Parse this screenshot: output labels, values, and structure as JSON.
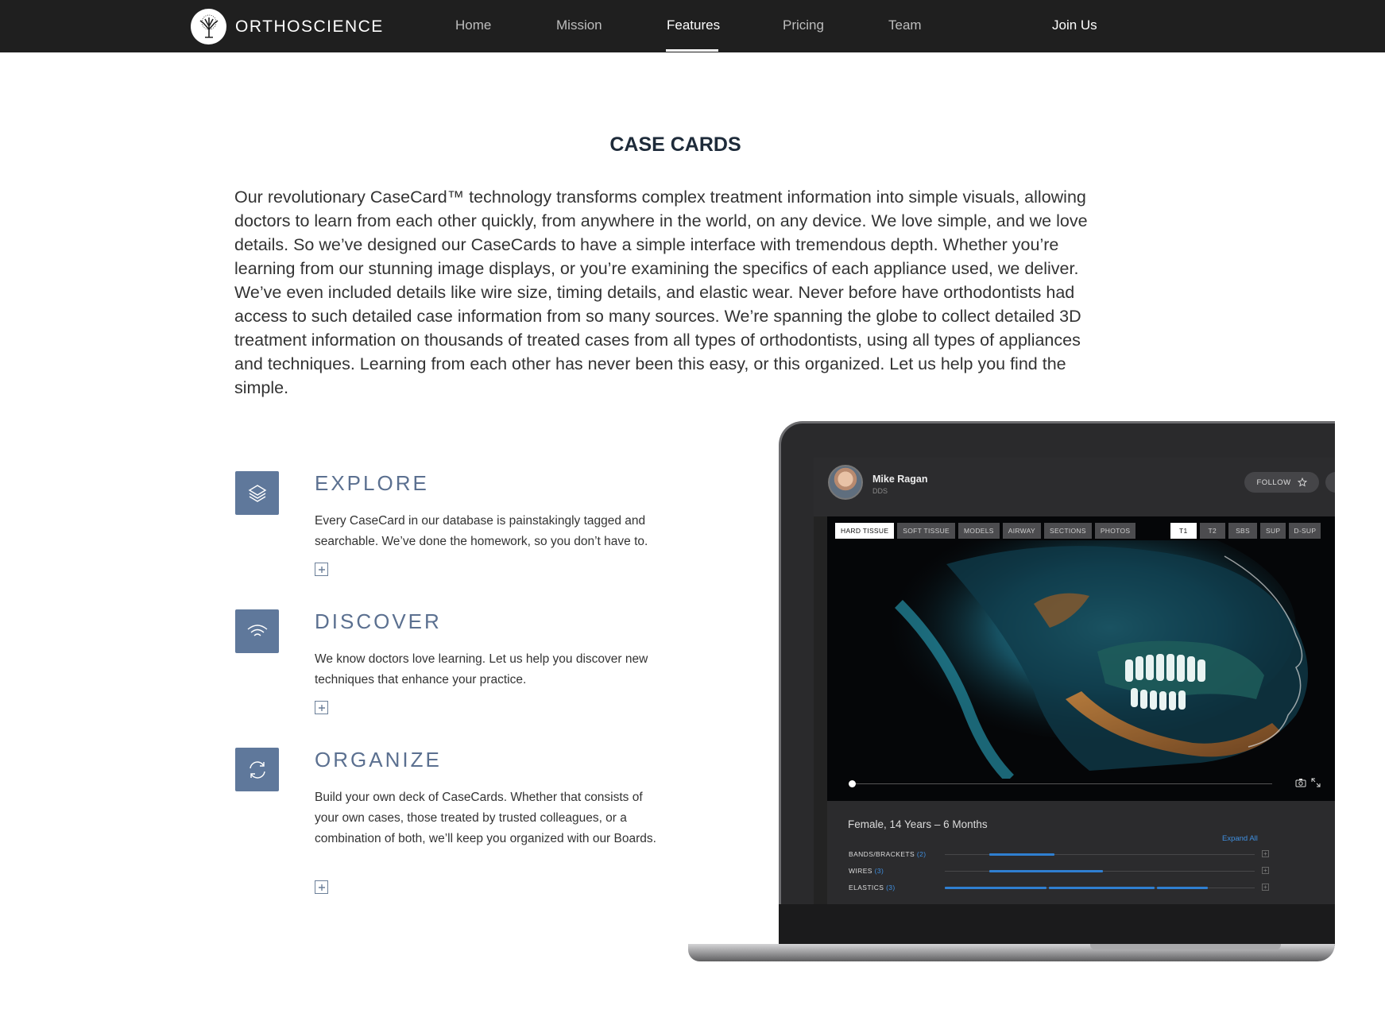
{
  "nav": {
    "brand": "ORTHOSCIENCE",
    "links": [
      "Home",
      "Mission",
      "Features",
      "Pricing",
      "Team"
    ],
    "active": "Features",
    "join": "Join Us"
  },
  "section": {
    "title": "CASE CARDS",
    "intro": "Our revolutionary CaseCard™ technology transforms complex treatment information into simple visuals, allowing doctors to learn from each other quickly, from anywhere in the world, on any device. We love simple, and we love details. So we’ve designed our CaseCards to have a simple interface with tremendous depth. Whether you’re learning from our stunning image displays, or you’re examining the specifics of each appliance used, we deliver. We’ve even included details like wire size, timing details, and elastic wear. Never before have orthodontists had access to such detailed case information from so many sources. We’re spanning the globe to collect detailed 3D treatment information on thousands of treated cases from all types of orthodontists, using all types of appliances and techniques. Learning from each other has never been this easy, or this organized. Let us help you find the simple."
  },
  "features": [
    {
      "icon": "layers-icon",
      "title": "EXPLORE",
      "text": "Every CaseCard in our database is painstakingly tagged and searchable. We’ve done the homework, so you don’t have to."
    },
    {
      "icon": "signal-icon",
      "title": "DISCOVER",
      "text": "We know doctors love learning. Let us help you discover new techniques that enhance your practice."
    },
    {
      "icon": "sync-icon",
      "title": "ORGANIZE",
      "text": "Build your own deck of CaseCards. Whether that consists of your own cases, those treated by trusted colleagues, or a combination of both, we’ll keep you organized with our Boards."
    }
  ],
  "casecard": {
    "doctor": "Mike Ragan",
    "doctor_title": "DDS",
    "follow": "FOLLOW",
    "tabs": [
      "HARD TISSUE",
      "SOFT TISSUE",
      "MODELS",
      "AIRWAY",
      "SECTIONS",
      "PHOTOS"
    ],
    "active_tab": "HARD TISSUE",
    "timepoints": [
      "T1",
      "T2",
      "SBS",
      "SUP",
      "D-SUP"
    ],
    "active_timepoint": "T1",
    "patient": "Female, 14 Years – 6 Months",
    "expand_all": "Expand All",
    "rows": [
      {
        "label": "BANDS/BRACKETS",
        "count": "(2)"
      },
      {
        "label": "WIRES",
        "count": "(3)"
      },
      {
        "label": "ELASTICS",
        "count": "(3)"
      }
    ]
  }
}
